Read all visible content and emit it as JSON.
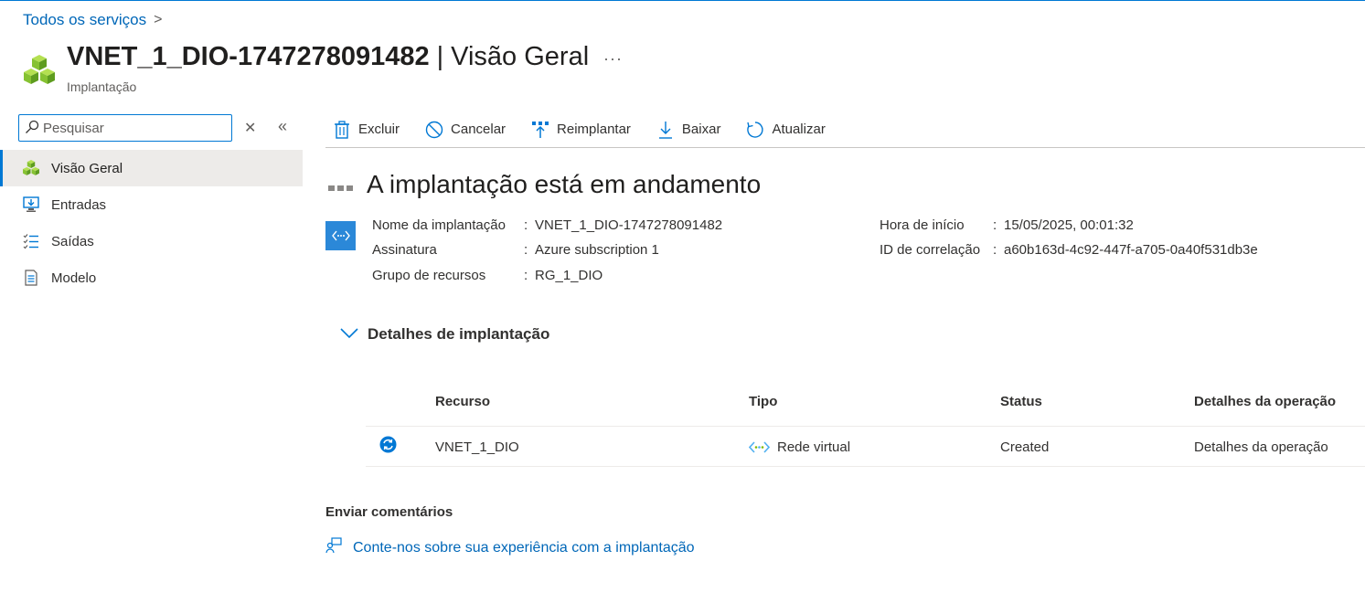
{
  "breadcrumb": {
    "root": "Todos os serviços",
    "chevron": ">"
  },
  "header": {
    "resource_name": "VNET_1_DIO-1747278091482",
    "separator": "|",
    "page_name": "Visão Geral",
    "more": "···",
    "subtitle": "Implantação",
    "icon": "deployment-cubes-icon"
  },
  "search": {
    "placeholder": "Pesquisar",
    "value": "",
    "clear": "✕",
    "collapse": "«"
  },
  "sidebar": {
    "items": [
      {
        "label": "Visão Geral",
        "icon": "deployment-cubes-icon",
        "active": true
      },
      {
        "label": "Entradas",
        "icon": "inputs-icon",
        "active": false
      },
      {
        "label": "Saídas",
        "icon": "outputs-list-icon",
        "active": false
      },
      {
        "label": "Modelo",
        "icon": "template-document-icon",
        "active": false
      }
    ]
  },
  "toolbar": {
    "delete": "Excluir",
    "cancel": "Cancelar",
    "redeploy": "Reimplantar",
    "download": "Baixar",
    "refresh": "Atualizar"
  },
  "status": {
    "title": "A implantação está em andamento"
  },
  "essentials": {
    "deployment_name_label": "Nome da implantação",
    "deployment_name_value": "VNET_1_DIO-1747278091482",
    "subscription_label": "Assinatura",
    "subscription_value": "Azure subscription 1",
    "resource_group_label": "Grupo de recursos",
    "resource_group_value": "RG_1_DIO",
    "start_time_label": "Hora de início",
    "start_time_value": "15/05/2025, 00:01:32",
    "correlation_label": "ID de correlação",
    "correlation_value": "a60b163d-4c92-447f-a705-0a40f531db3e",
    "colon": ":"
  },
  "details": {
    "title": "Detalhes de implantação",
    "columns": [
      "Recurso",
      "Tipo",
      "Status",
      "Detalhes da operação"
    ],
    "rows": [
      {
        "resource": "VNET_1_DIO",
        "type": "Rede virtual",
        "status": "Created",
        "operation": "Detalhes da operação"
      }
    ]
  },
  "feedback": {
    "title": "Enviar comentários",
    "link": "Conte-nos sobre sua experiência com a implantação"
  },
  "colors": {
    "accent": "#0078d4",
    "link": "#0067b8",
    "active_bg": "#edebe9"
  }
}
